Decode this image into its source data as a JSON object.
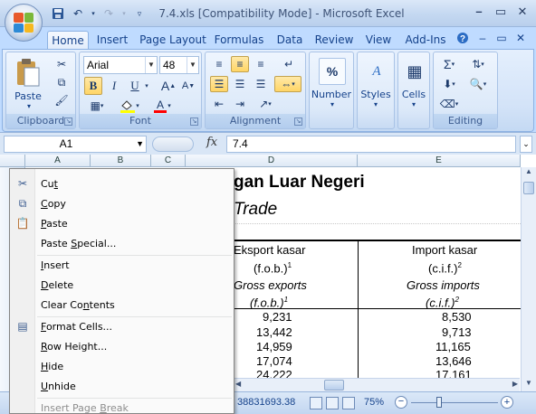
{
  "window": {
    "title": "7.4.xls  [Compatibility Mode] - Microsoft Excel",
    "controls": [
      "–",
      "▭",
      "✕"
    ]
  },
  "qat": {
    "save_icon": "save-icon",
    "undo_icon": "undo-icon",
    "redo_icon": "redo-icon"
  },
  "tabs": [
    "Home",
    "Insert",
    "Page Layout",
    "Formulas",
    "Data",
    "Review",
    "View",
    "Add-Ins"
  ],
  "ribbon": {
    "clipboard": {
      "label": "Clipboard",
      "paste": "Paste"
    },
    "font": {
      "label": "Font",
      "font_name": "Arial",
      "font_size": "48",
      "bold": "B",
      "italic": "I",
      "underline": "U"
    },
    "alignment": {
      "label": "Alignment"
    },
    "number": {
      "label": "Number",
      "symbol": "%"
    },
    "styles": {
      "label": "Styles"
    },
    "cells": {
      "label": "Cells"
    },
    "editing": {
      "label": "Editing",
      "sigma": "Σ"
    }
  },
  "formula_bar": {
    "name_box": "A1",
    "fx": "fx",
    "formula": "7.4"
  },
  "columns": [
    "A",
    "B",
    "C",
    "D",
    "E"
  ],
  "sheet": {
    "title_fragment": "gan Luar Negeri",
    "subtitle_fragment": "Trade",
    "col_d_header1": "Eksport kasar",
    "col_d_header2": "(f.o.b.)",
    "col_d_sup": "1",
    "col_d_header3": "Gross exports",
    "col_d_header4": "(f.o.b.)",
    "col_d_sup2": "1",
    "col_e_header1": "Import kasar",
    "col_e_header2": "(c.i.f.)",
    "col_e_sup": "2",
    "col_e_header3": "Gross imports",
    "col_e_header4": "(c.i.f.)",
    "col_e_sup2": "2",
    "rows": [
      {
        "d": "9,231",
        "e": "8,530"
      },
      {
        "d": "13,442",
        "e": "9,713"
      },
      {
        "d": "14,959",
        "e": "11,165"
      },
      {
        "d": "17,074",
        "e": "13,646"
      },
      {
        "d": "24,222",
        "e": "17,161"
      }
    ]
  },
  "status": {
    "sum": "38831693.38",
    "zoom": "75%"
  },
  "context_menu": {
    "items": [
      {
        "pre": "Cu",
        "ul": "t",
        "post": "",
        "icon": "scissors-icon",
        "disabled": false
      },
      {
        "pre": "",
        "ul": "C",
        "post": "opy",
        "icon": "copy-icon",
        "disabled": false
      },
      {
        "pre": "",
        "ul": "P",
        "post": "aste",
        "icon": "paste-icon",
        "disabled": false
      },
      {
        "pre": "Paste ",
        "ul": "S",
        "post": "pecial...",
        "icon": "",
        "disabled": false
      },
      {
        "pre": "",
        "ul": "I",
        "post": "nsert",
        "icon": "",
        "disabled": false
      },
      {
        "pre": "",
        "ul": "D",
        "post": "elete",
        "icon": "",
        "disabled": false
      },
      {
        "pre": "Clear Co",
        "ul": "n",
        "post": "tents",
        "icon": "",
        "disabled": false
      },
      {
        "pre": "",
        "ul": "F",
        "post": "ormat Cells...",
        "icon": "format-cells-icon",
        "disabled": false
      },
      {
        "pre": "",
        "ul": "R",
        "post": "ow Height...",
        "icon": "",
        "disabled": false
      },
      {
        "pre": "",
        "ul": "H",
        "post": "ide",
        "icon": "",
        "disabled": false
      },
      {
        "pre": "",
        "ul": "U",
        "post": "nhide",
        "icon": "",
        "disabled": false
      },
      {
        "pre": "Insert Page ",
        "ul": "B",
        "post": "reak",
        "icon": "",
        "disabled": true
      }
    ]
  }
}
